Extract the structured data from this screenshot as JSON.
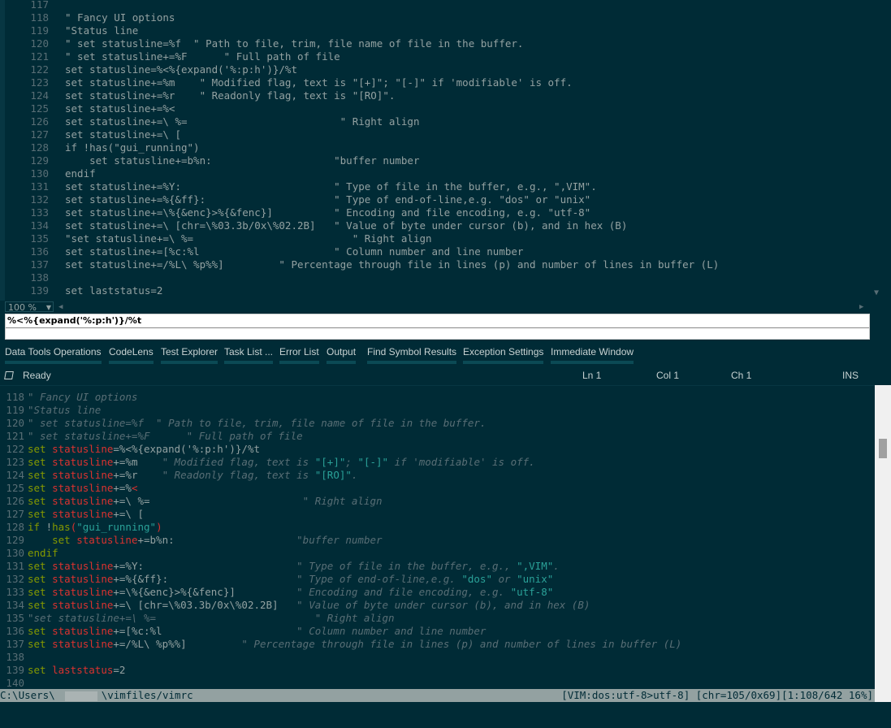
{
  "top_editor": {
    "lines": [
      {
        "n": "117",
        "t": ""
      },
      {
        "n": "118",
        "t": "\" Fancy UI options"
      },
      {
        "n": "119",
        "t": "\"Status line"
      },
      {
        "n": "120",
        "t": "\" set statusline=%f  \" Path to file, trim, file name of file in the buffer."
      },
      {
        "n": "121",
        "t": "\" set statusline+=%F      \" Full path of file"
      },
      {
        "n": "122",
        "t": "set statusline=%<%{expand('%:p:h')}/%t"
      },
      {
        "n": "123",
        "t": "set statusline+=%m    \" Modified flag, text is \"[+]\"; \"[-]\" if 'modifiable' is off."
      },
      {
        "n": "124",
        "t": "set statusline+=%r    \" Readonly flag, text is \"[RO]\"."
      },
      {
        "n": "125",
        "t": "set statusline+=%<"
      },
      {
        "n": "126",
        "t": "set statusline+=\\ %=                         \" Right align"
      },
      {
        "n": "127",
        "t": "set statusline+=\\ ["
      },
      {
        "n": "128",
        "t": "if !has(\"gui_running\")"
      },
      {
        "n": "129",
        "t": "    set statusline+=b%n:                    \"buffer number"
      },
      {
        "n": "130",
        "t": "endif"
      },
      {
        "n": "131",
        "t": "set statusline+=%Y:                         \" Type of file in the buffer, e.g., \",VIM\"."
      },
      {
        "n": "132",
        "t": "set statusline+=%{&ff}:                     \" Type of end-of-line,e.g. \"dos\" or \"unix\""
      },
      {
        "n": "133",
        "t": "set statusline+=\\%{&enc}>%{&fenc}]          \" Encoding and file encoding, e.g. \"utf-8\""
      },
      {
        "n": "134",
        "t": "set statusline+=\\ [chr=\\%03.3b/0x\\%02.2B]   \" Value of byte under cursor (b), and in hex (B)"
      },
      {
        "n": "135",
        "t": "\"set statusline+=\\ %=                          \" Right align"
      },
      {
        "n": "136",
        "t": "set statusline+=[%c:%l                      \" Column number and line number"
      },
      {
        "n": "137",
        "t": "set statusline+=/%L\\ %p%%]         \" Percentage through file in lines (p) and number of lines in buffer (L)"
      },
      {
        "n": "138",
        "t": ""
      },
      {
        "n": "139",
        "t": "set laststatus=2"
      }
    ]
  },
  "zoom": {
    "value": "100 %"
  },
  "find": {
    "value": "%<%{expand('%:p:h')}/%t"
  },
  "tool_tabs": [
    "Data Tools Operations",
    "CodeLens",
    "Test Explorer",
    "Task List ...",
    "Error List",
    "Output",
    "Find Symbol Results",
    "Exception Settings",
    "Immediate Window"
  ],
  "status_bar": {
    "ready": "Ready",
    "ln": "Ln 1",
    "col": "Col 1",
    "ch": "Ch 1",
    "ins": "INS"
  },
  "vim": {
    "lines": [
      {
        "n": "118",
        "segs": [
          [
            "cm",
            "\" Fancy UI options"
          ]
        ]
      },
      {
        "n": "119",
        "segs": [
          [
            "cm",
            "\"Status line"
          ]
        ]
      },
      {
        "n": "120",
        "segs": [
          [
            "cm",
            "\" set statusline=%f  \" Path to file, trim, file name of file in the buffer."
          ]
        ]
      },
      {
        "n": "121",
        "segs": [
          [
            "cm",
            "\" set statusline+=%F      \" Full path of file"
          ]
        ]
      },
      {
        "n": "122",
        "segs": [
          [
            "kw",
            "set "
          ],
          [
            "op",
            "statusline"
          ],
          [
            "tx",
            "=%<%{expand('%:p:h')}/%t"
          ]
        ]
      },
      {
        "n": "123",
        "segs": [
          [
            "kw",
            "set "
          ],
          [
            "op",
            "statusline"
          ],
          [
            "tx",
            "+=%m    "
          ],
          [
            "cm",
            "\" Modified flag, text is "
          ],
          [
            "st",
            "\"[+]\""
          ],
          [
            "cm",
            "; "
          ],
          [
            "st",
            "\"[-]\""
          ],
          [
            "cm",
            " if 'modifiable' is off."
          ]
        ]
      },
      {
        "n": "124",
        "segs": [
          [
            "kw",
            "set "
          ],
          [
            "op",
            "statusline"
          ],
          [
            "tx",
            "+=%r    "
          ],
          [
            "cm",
            "\" Readonly flag, text is "
          ],
          [
            "st",
            "\"[RO]\""
          ],
          [
            "cm",
            "."
          ]
        ]
      },
      {
        "n": "125",
        "segs": [
          [
            "kw",
            "set "
          ],
          [
            "op",
            "statusline"
          ],
          [
            "tx",
            "+=%"
          ],
          [
            "op",
            "<"
          ]
        ]
      },
      {
        "n": "126",
        "segs": [
          [
            "kw",
            "set "
          ],
          [
            "op",
            "statusline"
          ],
          [
            "tx",
            "+=\\ %=                         "
          ],
          [
            "cm",
            "\" Right align"
          ]
        ]
      },
      {
        "n": "127",
        "segs": [
          [
            "kw",
            "set "
          ],
          [
            "op",
            "statusline"
          ],
          [
            "tx",
            "+=\\ ["
          ]
        ]
      },
      {
        "n": "128",
        "segs": [
          [
            "kw",
            "if "
          ],
          [
            "tx",
            "!"
          ],
          [
            "kw",
            "has"
          ],
          [
            "op",
            "("
          ],
          [
            "st",
            "\"gui_running\""
          ],
          [
            "op",
            ")"
          ]
        ]
      },
      {
        "n": "129",
        "segs": [
          [
            "tx",
            "    "
          ],
          [
            "kw",
            "set "
          ],
          [
            "op",
            "statusline"
          ],
          [
            "tx",
            "+=b%n:                    "
          ],
          [
            "cm",
            "\"buffer number"
          ]
        ]
      },
      {
        "n": "130",
        "segs": [
          [
            "kw",
            "endif"
          ]
        ]
      },
      {
        "n": "131",
        "segs": [
          [
            "kw",
            "set "
          ],
          [
            "op",
            "statusline"
          ],
          [
            "tx",
            "+=%Y:                         "
          ],
          [
            "cm",
            "\" Type of file in the buffer, e.g., "
          ],
          [
            "st",
            "\",VIM\""
          ],
          [
            "cm",
            "."
          ]
        ]
      },
      {
        "n": "132",
        "segs": [
          [
            "kw",
            "set "
          ],
          [
            "op",
            "statusline"
          ],
          [
            "tx",
            "+=%{&ff}:                     "
          ],
          [
            "cm",
            "\" Type of end-of-line,e.g. "
          ],
          [
            "st",
            "\"dos\""
          ],
          [
            "cm",
            " or "
          ],
          [
            "st",
            "\"unix\""
          ]
        ]
      },
      {
        "n": "133",
        "segs": [
          [
            "kw",
            "set "
          ],
          [
            "op",
            "statusline"
          ],
          [
            "tx",
            "+=\\%{&enc}>%{&fenc}]          "
          ],
          [
            "cm",
            "\" Encoding and file encoding, e.g. "
          ],
          [
            "st",
            "\"utf-8\""
          ]
        ]
      },
      {
        "n": "134",
        "segs": [
          [
            "kw",
            "set "
          ],
          [
            "op",
            "statusline"
          ],
          [
            "tx",
            "+=\\ [chr=\\%03.3b/0x\\%02.2B]   "
          ],
          [
            "cm",
            "\" Value of byte under cursor (b), and in hex (B)"
          ]
        ]
      },
      {
        "n": "135",
        "segs": [
          [
            "cm",
            "\"set statusline+=\\ %=                          \" Right align"
          ]
        ]
      },
      {
        "n": "136",
        "segs": [
          [
            "kw",
            "set "
          ],
          [
            "op",
            "statusline"
          ],
          [
            "tx",
            "+=[%c:%l                      "
          ],
          [
            "cm",
            "\" Column number and line number"
          ]
        ]
      },
      {
        "n": "137",
        "segs": [
          [
            "kw",
            "set "
          ],
          [
            "op",
            "statusline"
          ],
          [
            "tx",
            "+=/%L\\ %p%%]         "
          ],
          [
            "cm",
            "\" Percentage through file in lines (p) and number of lines in buffer (L)"
          ]
        ]
      },
      {
        "n": "138",
        "segs": []
      },
      {
        "n": "139",
        "segs": [
          [
            "kw",
            "set "
          ],
          [
            "op",
            "laststatus"
          ],
          [
            "tx",
            "=2"
          ]
        ]
      },
      {
        "n": "140",
        "segs": []
      }
    ],
    "status_left_a": "C:\\Users\\",
    "status_left_b": "\\vimfiles/vimrc",
    "status_right": "[VIM:dos:utf-8>utf-8] [chr=105/0x69][1:108/642 16%]"
  },
  "colors": {
    "bg": "#002b36",
    "comment": "#586e75",
    "keyword": "#859900",
    "option": "#dc322f",
    "string": "#2aa198",
    "text": "#93a1a1"
  }
}
